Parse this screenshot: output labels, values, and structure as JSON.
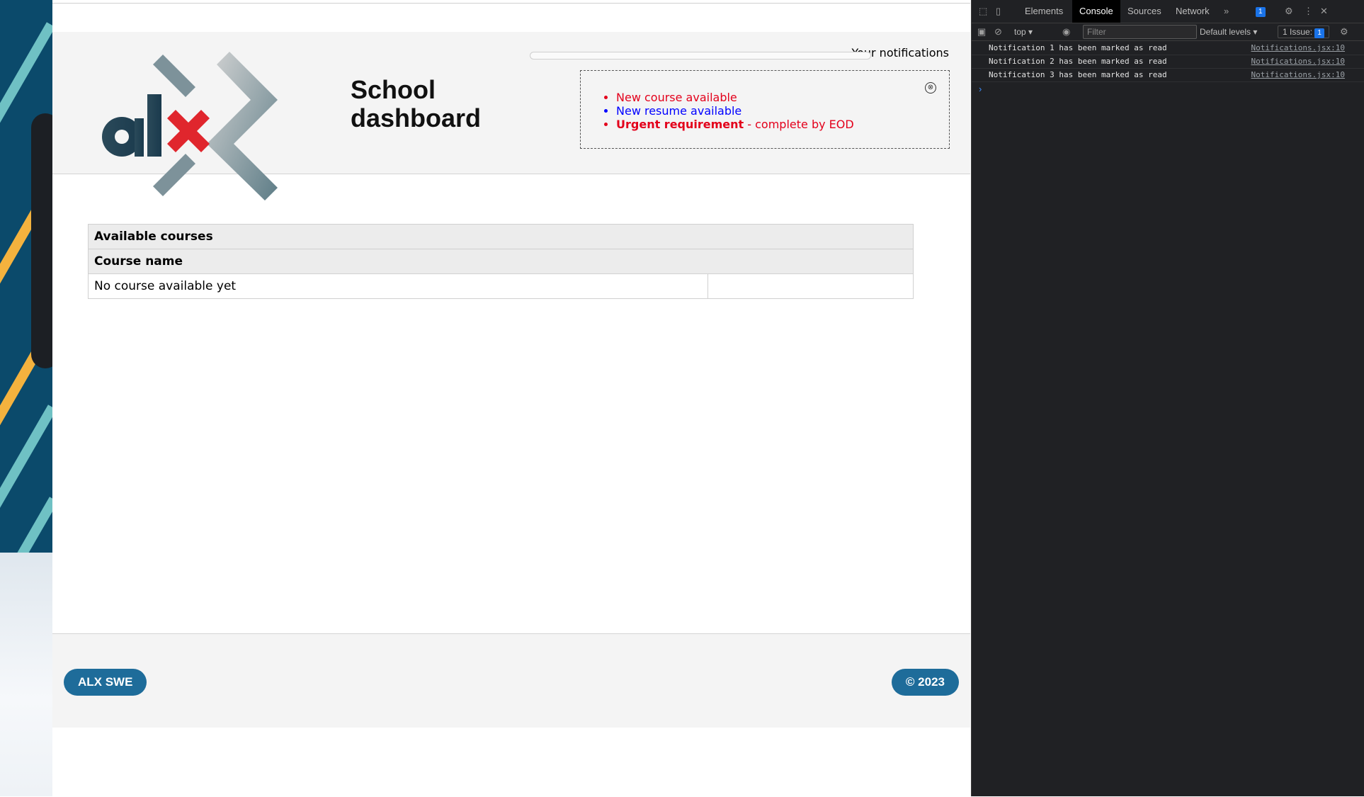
{
  "app": {
    "title": "School dashboard",
    "notifications": {
      "heading": "Your notifications",
      "items": [
        {
          "text": "New course available",
          "priority": "default",
          "color": "#e3001b"
        },
        {
          "text": "New resume available",
          "priority": "urgent",
          "color": "#0000ff"
        },
        {
          "strong": "Urgent requirement",
          "text": " - complete by EOD",
          "priority": "urgent",
          "color": "#e3001b"
        }
      ],
      "close_label": "⊗"
    },
    "course_list": {
      "header_title": "Available courses",
      "column_header": "Course name",
      "empty_text": "No course available yet"
    },
    "footer": {
      "left_label": "ALX SWE",
      "right_label": "© 2023",
      "accent": "#1e6c9a"
    }
  },
  "devtools": {
    "tabs": [
      "Elements",
      "Console",
      "Sources",
      "Network"
    ],
    "active_tab": "Console",
    "more_tabs_icon": "»",
    "messages_badge": "1",
    "context_selector": "top ▾",
    "filter_placeholder": "Filter",
    "levels_selector": "Default levels ▾",
    "issues_label": "1 Issue:",
    "issues_badge": "1",
    "console_messages": [
      {
        "text": "Notification 1 has been marked as read",
        "source": "Notifications.jsx:10"
      },
      {
        "text": "Notification 2 has been marked as read",
        "source": "Notifications.jsx:10"
      },
      {
        "text": "Notification 3 has been marked as read",
        "source": "Notifications.jsx:10"
      }
    ],
    "prompt_symbol": "›"
  }
}
